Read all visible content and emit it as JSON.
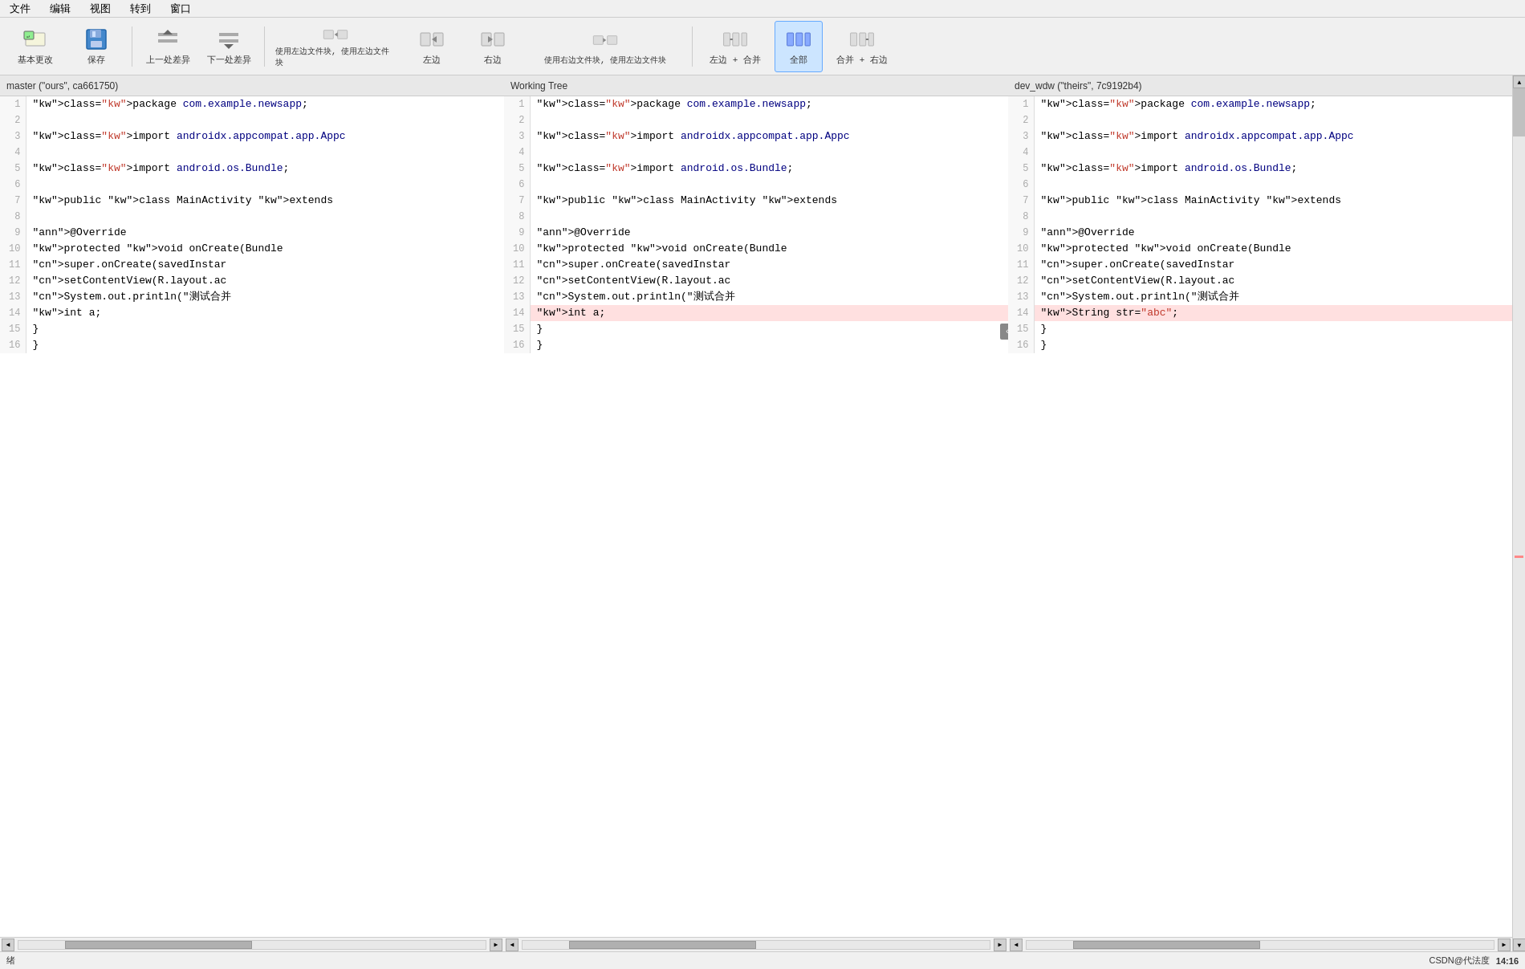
{
  "menu": {
    "items": [
      "文件",
      "编辑",
      "视图",
      "转到",
      "窗口"
    ]
  },
  "toolbar": {
    "btn_revert": "基本更改",
    "btn_save": "保存",
    "btn_prev_diff": "上一处差异",
    "btn_next_diff": "下一处差异",
    "btn_use_left_file": "使用左边文件块, 使用左边文件块",
    "btn_left": "左边",
    "btn_right": "右边",
    "btn_use_right_file": "使用右边文件块, 使用左边文件块",
    "btn_left_plus_merge": "左边 + 合并",
    "btn_all": "全部",
    "btn_merge_plus_right": "合并 + 右边"
  },
  "panels": {
    "left": {
      "header": "master (\"ours\", ca661750)",
      "lines": [
        {
          "num": 1,
          "content": "package com.example.newsapp;",
          "changed": false
        },
        {
          "num": 2,
          "content": "",
          "changed": false
        },
        {
          "num": 3,
          "content": "import androidx.appcompat.app.Appc",
          "changed": false
        },
        {
          "num": 4,
          "content": "",
          "changed": false
        },
        {
          "num": 5,
          "content": "import android.os.Bundle;",
          "changed": false
        },
        {
          "num": 6,
          "content": "",
          "changed": false
        },
        {
          "num": 7,
          "content": "public class MainActivity extends",
          "changed": false
        },
        {
          "num": 8,
          "content": "",
          "changed": false
        },
        {
          "num": 9,
          "content": "    @Override",
          "changed": false
        },
        {
          "num": 10,
          "content": "    protected void onCreate(Bundle",
          "changed": false
        },
        {
          "num": 11,
          "content": "        super.onCreate(savedInstar",
          "changed": false
        },
        {
          "num": 12,
          "content": "        setContentView(R.layout.ac",
          "changed": false
        },
        {
          "num": 13,
          "content": "        System.out.println(\"测试合并",
          "changed": false
        },
        {
          "num": 14,
          "content": "        int a;",
          "changed": false
        },
        {
          "num": 15,
          "content": "    }",
          "changed": false
        },
        {
          "num": 16,
          "content": "}",
          "changed": false
        }
      ]
    },
    "middle": {
      "header": "Working Tree",
      "lines": [
        {
          "num": 1,
          "content": "package com.example.newsapp;",
          "changed": false
        },
        {
          "num": 2,
          "content": "",
          "changed": false
        },
        {
          "num": 3,
          "content": "import androidx.appcompat.app.Appc",
          "changed": false
        },
        {
          "num": 4,
          "content": "",
          "changed": false
        },
        {
          "num": 5,
          "content": "import android.os.Bundle;",
          "changed": false
        },
        {
          "num": 6,
          "content": "",
          "changed": false
        },
        {
          "num": 7,
          "content": "public class MainActivity extends",
          "changed": false
        },
        {
          "num": 8,
          "content": "",
          "changed": false
        },
        {
          "num": 9,
          "content": "    @Override",
          "changed": false
        },
        {
          "num": 10,
          "content": "    protected void onCreate(Bundle",
          "changed": false
        },
        {
          "num": 11,
          "content": "        super.onCreate(savedInstar",
          "changed": false
        },
        {
          "num": 12,
          "content": "        setContentView(R.layout.ac",
          "changed": false
        },
        {
          "num": 13,
          "content": "        System.out.println(\"测试合并",
          "changed": false
        },
        {
          "num": 14,
          "content": "        int a;",
          "changed": true
        },
        {
          "num": 15,
          "content": "    }",
          "changed": false
        },
        {
          "num": 16,
          "content": "}",
          "changed": false
        }
      ]
    },
    "right": {
      "header": "dev_wdw (\"theirs\", 7c9192b4)",
      "lines": [
        {
          "num": 1,
          "content": "package com.example.newsapp;",
          "changed": false
        },
        {
          "num": 2,
          "content": "",
          "changed": false
        },
        {
          "num": 3,
          "content": "import androidx.appcompat.app.Appc",
          "changed": false
        },
        {
          "num": 4,
          "content": "",
          "changed": false
        },
        {
          "num": 5,
          "content": "import android.os.Bundle;",
          "changed": false
        },
        {
          "num": 6,
          "content": "",
          "changed": false
        },
        {
          "num": 7,
          "content": "public class MainActivity extends",
          "changed": false
        },
        {
          "num": 8,
          "content": "",
          "changed": false
        },
        {
          "num": 9,
          "content": "    @Override",
          "changed": false
        },
        {
          "num": 10,
          "content": "    protected void onCreate(Bundle",
          "changed": false
        },
        {
          "num": 11,
          "content": "        super.onCreate(savedInstar",
          "changed": false
        },
        {
          "num": 12,
          "content": "        setContentView(R.layout.ac",
          "changed": false
        },
        {
          "num": 13,
          "content": "        System.out.println(\"测试合并",
          "changed": false
        },
        {
          "num": 14,
          "content": "        String str=\"abc\";",
          "changed": true
        },
        {
          "num": 15,
          "content": "    }",
          "changed": false
        },
        {
          "num": 16,
          "content": "}",
          "changed": false
        }
      ]
    }
  },
  "status": {
    "left_text": "绪",
    "right_text": "CSDN@代法度",
    "time": "14:16"
  }
}
